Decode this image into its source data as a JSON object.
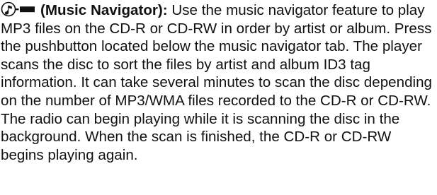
{
  "section": {
    "icon": "music-navigator-icon",
    "heading": "(Music Navigator):",
    "body": " Use the music navigator feature to play MP3 files on the CD-R or CD-RW in order by artist or album. Press the pushbutton located below the music navigator tab. The player scans the disc to sort the files by artist and album ID3 tag information. It can take several minutes to scan the disc depending on the number of MP3/WMA files recorded to the CD-R or CD-RW. The radio can begin playing while it is scanning the disc in the background. When the scan is finished, the CD-R or CD-RW begins playing again."
  }
}
